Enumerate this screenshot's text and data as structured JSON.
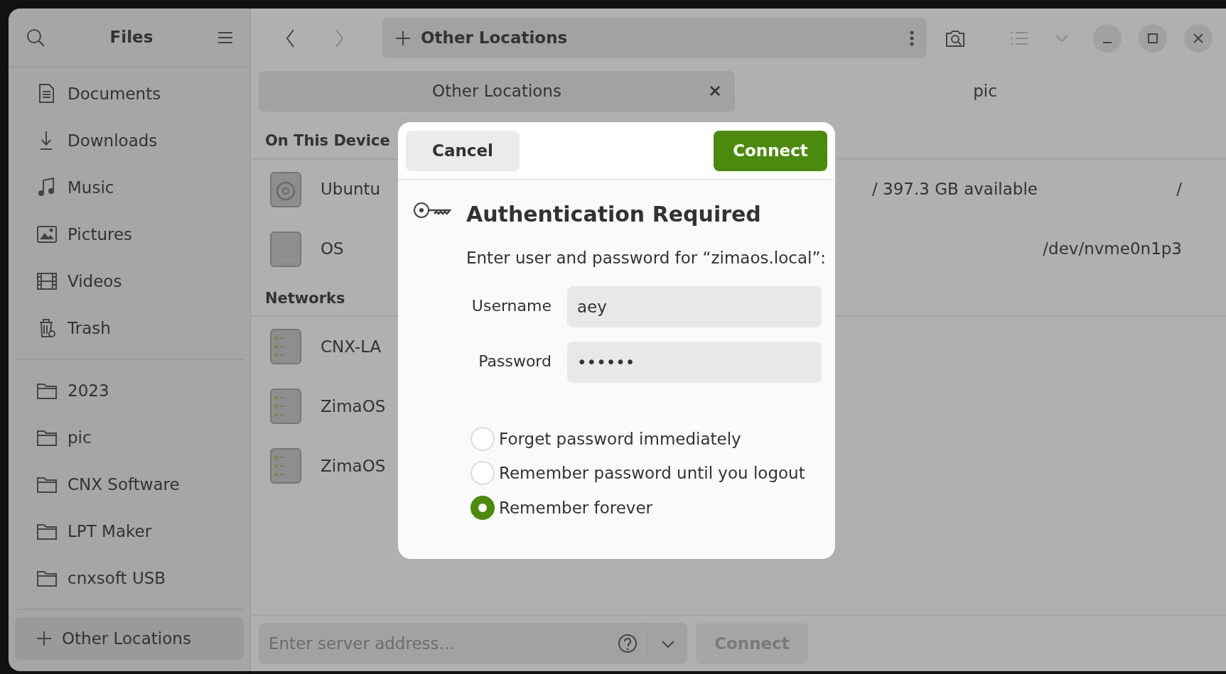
{
  "sidebar": {
    "title": "Files",
    "places": [
      {
        "label": "Documents",
        "selected": false
      },
      {
        "label": "Downloads",
        "selected": false
      },
      {
        "label": "Music",
        "selected": false
      },
      {
        "label": "Pictures",
        "selected": false
      },
      {
        "label": "Videos",
        "selected": false
      },
      {
        "label": "Trash",
        "selected": false
      }
    ],
    "bookmarks": [
      {
        "label": "2023",
        "selected": false
      },
      {
        "label": "pic",
        "selected": false
      },
      {
        "label": "CNX Software",
        "selected": false
      },
      {
        "label": "LPT Maker",
        "selected": false
      },
      {
        "label": "cnxsoft USB",
        "selected": false
      }
    ],
    "other_locations": {
      "label": "Other Locations",
      "selected": true
    }
  },
  "location": "Other Locations",
  "tabs": [
    {
      "label": "Other Locations",
      "selected": true
    },
    {
      "label": "pic",
      "selected": false
    }
  ],
  "sections": [
    {
      "title": "On This Device",
      "items": [
        {
          "kind": "drive",
          "name": "Ubuntu",
          "detail": "/ 397.3 GB available",
          "path": "/"
        },
        {
          "kind": "ssd",
          "name": "OS",
          "path": "/dev/nvme0n1p3"
        }
      ]
    },
    {
      "title": "Networks",
      "items": [
        {
          "kind": "server",
          "name": "CNX-LA"
        },
        {
          "kind": "server",
          "name": "ZimaOS"
        },
        {
          "kind": "server",
          "name": "ZimaOS"
        }
      ]
    }
  ],
  "server_bar": {
    "placeholder": "Enter server address…",
    "connect": {
      "label": "Connect",
      "disabled": true
    }
  },
  "dialog": {
    "cancel": "Cancel",
    "confirm": "Connect",
    "title": "Authentication Required",
    "message": "Enter user and password for “zimaos.local”:",
    "username": {
      "label": "Username",
      "value": "aey"
    },
    "password": {
      "label": "Password",
      "value": "••••••"
    },
    "options": [
      {
        "label": "Forget password immediately",
        "selected": false
      },
      {
        "label": "Remember password until you logout",
        "selected": false
      },
      {
        "label": "Remember forever",
        "selected": true
      }
    ]
  }
}
